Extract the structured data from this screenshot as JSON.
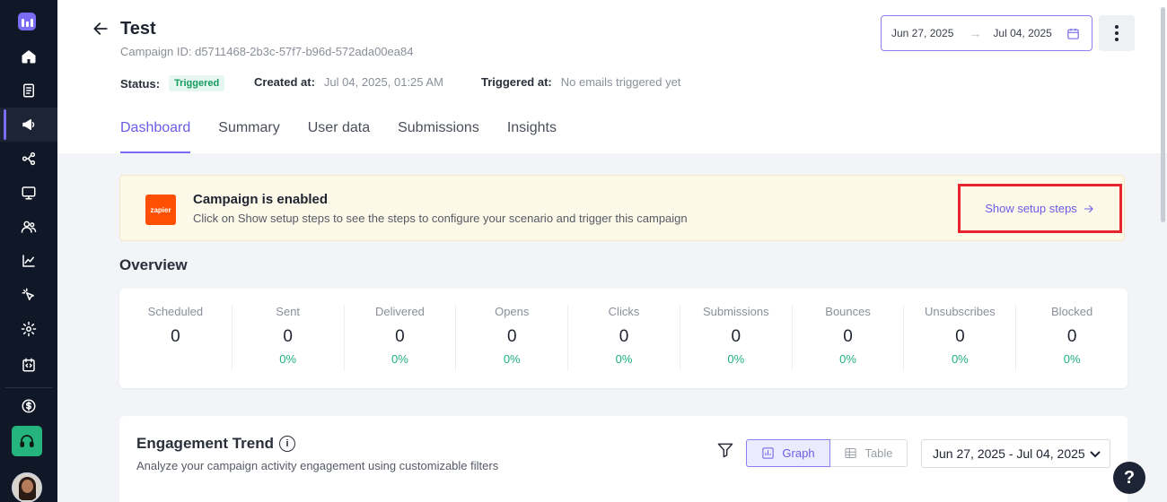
{
  "header": {
    "title": "Test",
    "campaign_id": "Campaign ID: d5711468-2b3c-57f7-b96d-572ada00ea84",
    "status_label": "Status:",
    "status_value": "Triggered",
    "created_label": "Created at:",
    "created_value": "Jul 04, 2025, 01:25 AM",
    "triggered_label": "Triggered at:",
    "triggered_value": "No emails triggered yet",
    "date_from": "Jun 27, 2025",
    "date_to": "Jul 04, 2025"
  },
  "tabs": [
    {
      "label": "Dashboard"
    },
    {
      "label": "Summary"
    },
    {
      "label": "User data"
    },
    {
      "label": "Submissions"
    },
    {
      "label": "Insights"
    }
  ],
  "banner": {
    "logo_text": "zapier",
    "title": "Campaign is enabled",
    "description": "Click on Show setup steps to see the steps to configure your scenario and trigger this campaign",
    "link_label": "Show setup steps"
  },
  "overview": {
    "title": "Overview",
    "stats": [
      {
        "label": "Scheduled",
        "value": "0",
        "pct": ""
      },
      {
        "label": "Sent",
        "value": "0",
        "pct": "0%"
      },
      {
        "label": "Delivered",
        "value": "0",
        "pct": "0%"
      },
      {
        "label": "Opens",
        "value": "0",
        "pct": "0%"
      },
      {
        "label": "Clicks",
        "value": "0",
        "pct": "0%"
      },
      {
        "label": "Submissions",
        "value": "0",
        "pct": "0%"
      },
      {
        "label": "Bounces",
        "value": "0",
        "pct": "0%"
      },
      {
        "label": "Unsubscribes",
        "value": "0",
        "pct": "0%"
      },
      {
        "label": "Blocked",
        "value": "0",
        "pct": "0%"
      }
    ]
  },
  "engagement": {
    "title": "Engagement Trend",
    "info_glyph": "i",
    "subtitle": "Analyze your campaign activity engagement using customizable filters",
    "graph_label": "Graph",
    "table_label": "Table",
    "date_range": "Jun 27, 2025 - Jul 04, 2025"
  },
  "help_glyph": "?",
  "colors": {
    "accent": "#7b6cf6",
    "sidebar": "#101726",
    "success": "#1fb27a",
    "highlight": "#e8242e"
  }
}
